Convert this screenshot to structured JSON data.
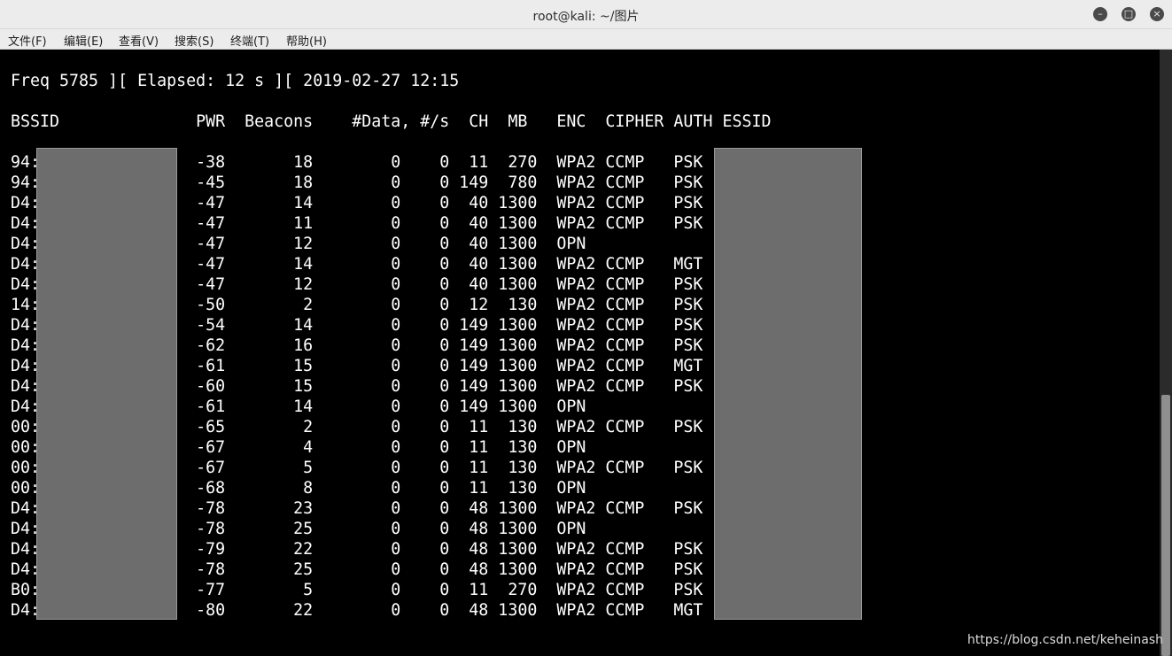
{
  "window": {
    "title": "root@kali: ~/图片",
    "buttons": {
      "minimize": "–",
      "maximize": "□",
      "close": "×"
    }
  },
  "menu": [
    "文件(F)",
    "编辑(E)",
    "查看(V)",
    "搜索(S)",
    "终端(T)",
    "帮助(H)"
  ],
  "terminal": {
    "status_line": "Freq 5785 ][ Elapsed: 12 s ][ 2019-02-27 12:15",
    "header_line": "BSSID              PWR  Beacons    #Data, #/s  CH  MB   ENC  CIPHER AUTH ESSID",
    "rows": [
      "94:                -38       18        0    0  11  270  WPA2 CCMP   PSK",
      "94:                -45       18        0    0 149  780  WPA2 CCMP   PSK",
      "D4:                -47       14        0    0  40 1300  WPA2 CCMP   PSK",
      "D4:                -47       11        0    0  40 1300  WPA2 CCMP   PSK",
      "D4:                -47       12        0    0  40 1300  OPN",
      "D4:                -47       14        0    0  40 1300  WPA2 CCMP   MGT",
      "D4:                -47       12        0    0  40 1300  WPA2 CCMP   PSK",
      "14:                -50        2        0    0  12  130  WPA2 CCMP   PSK",
      "D4:                -54       14        0    0 149 1300  WPA2 CCMP   PSK",
      "D4:                -62       16        0    0 149 1300  WPA2 CCMP   PSK",
      "D4:                -61       15        0    0 149 1300  WPA2 CCMP   MGT",
      "D4:                -60       15        0    0 149 1300  WPA2 CCMP   PSK",
      "D4:                -61       14        0    0 149 1300  OPN",
      "00:                -65        2        0    0  11  130  WPA2 CCMP   PSK",
      "00:                -67        4        0    0  11  130  OPN",
      "00:                -67        5        0    0  11  130  WPA2 CCMP   PSK",
      "00:                -68        8        0    0  11  130  OPN",
      "D4:                -78       23        0    0  48 1300  WPA2 CCMP   PSK",
      "D4:                -78       25        0    0  48 1300  OPN",
      "D4:                -79       22        0    0  48 1300  WPA2 CCMP   PSK",
      "D4:                -78       25        0    0  48 1300  WPA2 CCMP   PSK",
      "B0:                -77        5        0    0  11  270  WPA2 CCMP   PSK",
      "D4:                -80       22        0    0  48 1300  WPA2 CCMP   MGT"
    ]
  },
  "watermark": "https://blog.csdn.net/keheinash",
  "colors": {
    "titlebar_bg": "#ececec",
    "terminal_bg": "#000000",
    "terminal_fg": "#ffffff",
    "redaction": "#6d6d6d"
  }
}
